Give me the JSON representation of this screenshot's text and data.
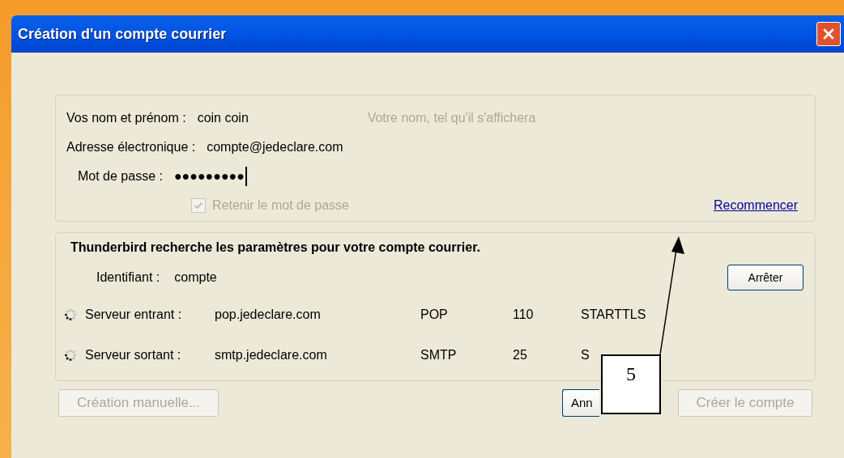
{
  "window": {
    "title": "Création d'un compte courrier"
  },
  "account": {
    "fields": [
      {
        "kind": "text",
        "label": "Vos nom et prénom :",
        "value": "coin coin",
        "hint": "Votre nom, tel qu'il s'affichera"
      },
      {
        "kind": "text",
        "label": "Adresse électronique :",
        "value": "compte@jedeclare.com"
      },
      {
        "kind": "password",
        "label": "Mot de passe :",
        "value": "●●●●●●●●●"
      }
    ],
    "remember": {
      "label": "Retenir le mot de passe",
      "checked": true,
      "disabled": true
    },
    "restart_link": "Recommencer"
  },
  "search": {
    "heading": "Thunderbird recherche les paramètres pour votre compte courrier.",
    "identifier": {
      "label": "Identifiant :",
      "value": "compte"
    },
    "stop_button": "Arrêter",
    "servers": [
      {
        "label": "Serveur entrant :",
        "host": "pop.jedeclare.com",
        "protocol": "POP",
        "port": "110",
        "security": "STARTTLS"
      },
      {
        "label": "Serveur sortant :",
        "host": "smtp.jedeclare.com",
        "protocol": "SMTP",
        "port": "25",
        "security": "S"
      }
    ]
  },
  "buttons": [
    {
      "label": "Création manuelle...",
      "disabled": true
    },
    {
      "label": "Ann",
      "disabled": false
    },
    {
      "label": "Créer le compte",
      "disabled": true
    }
  ],
  "callout": {
    "label": "5"
  }
}
